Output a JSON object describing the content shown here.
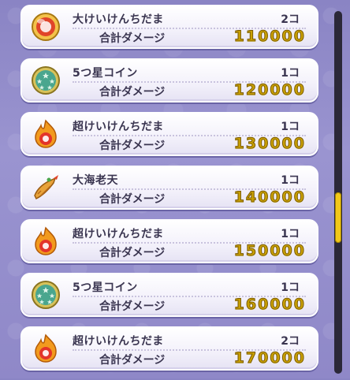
{
  "items": [
    {
      "name": "大けいけんちだま",
      "count": "2コ",
      "damage_label": "合計ダメージ",
      "damage": "110000",
      "icon": "red-exp-orb-icon"
    },
    {
      "name": "5つ星コイン",
      "count": "1コ",
      "damage_label": "合計ダメージ",
      "damage": "120000",
      "icon": "five-star-coin-icon"
    },
    {
      "name": "超けいけんちだま",
      "count": "1コ",
      "damage_label": "合計ダメージ",
      "damage": "130000",
      "icon": "super-exp-orb-icon"
    },
    {
      "name": "大海老天",
      "count": "1コ",
      "damage_label": "合計ダメージ",
      "damage": "140000",
      "icon": "shrimp-tempura-icon"
    },
    {
      "name": "超けいけんちだま",
      "count": "1コ",
      "damage_label": "合計ダメージ",
      "damage": "150000",
      "icon": "super-exp-orb-icon"
    },
    {
      "name": "5つ星コイン",
      "count": "1コ",
      "damage_label": "合計ダメージ",
      "damage": "160000",
      "icon": "five-star-coin-icon"
    },
    {
      "name": "超けいけんちだま",
      "count": "2コ",
      "damage_label": "合計ダメージ",
      "damage": "170000",
      "icon": "super-exp-orb-icon"
    }
  ],
  "scrollbar": {
    "position_fraction": 0.58,
    "visible_fraction": 0.14
  },
  "colors": {
    "damage_gold": "#c9a000",
    "scroll_thumb": "#f2c81a",
    "background": "#8a84c4"
  }
}
